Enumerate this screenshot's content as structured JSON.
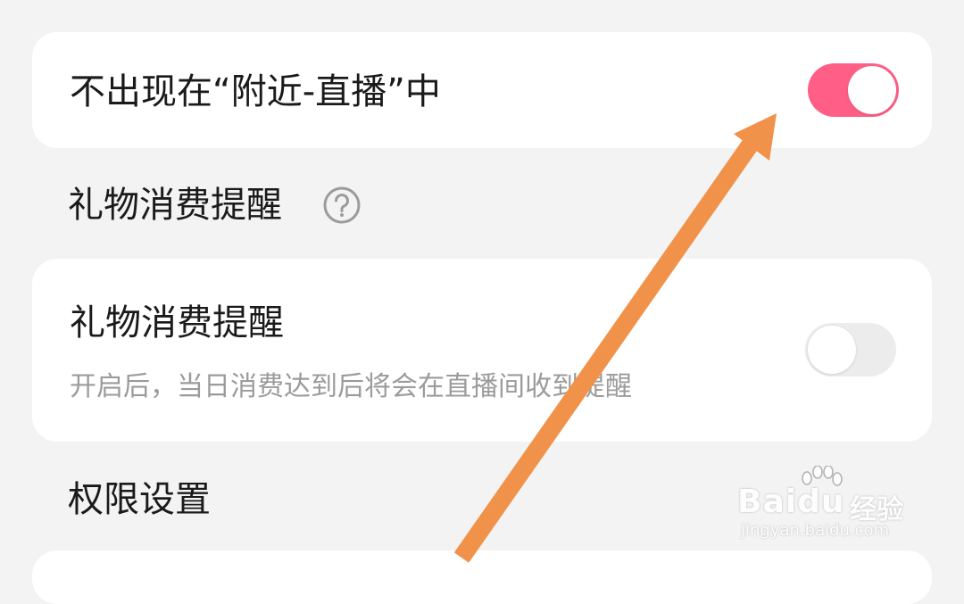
{
  "settings": {
    "nearby_live": {
      "label": "不出现在“附近-直播”中",
      "enabled": true
    },
    "gift_section": {
      "title": "礼物消费提醒",
      "help_icon": "question-circle-icon"
    },
    "gift_reminder": {
      "label": "礼物消费提醒",
      "description": "开启后，当日消费达到后将会在直播间收到提醒",
      "enabled": false
    },
    "permission_section": {
      "title": "权限设置"
    }
  },
  "colors": {
    "toggle_on": "#ff5f86",
    "toggle_off": "#ececec",
    "arrow": "#f0924a",
    "background": "#f3f3f3",
    "card": "#ffffff"
  },
  "watermark": {
    "logo": "Baidu",
    "brand": "经验",
    "url": "jingyan.baidu.com"
  }
}
